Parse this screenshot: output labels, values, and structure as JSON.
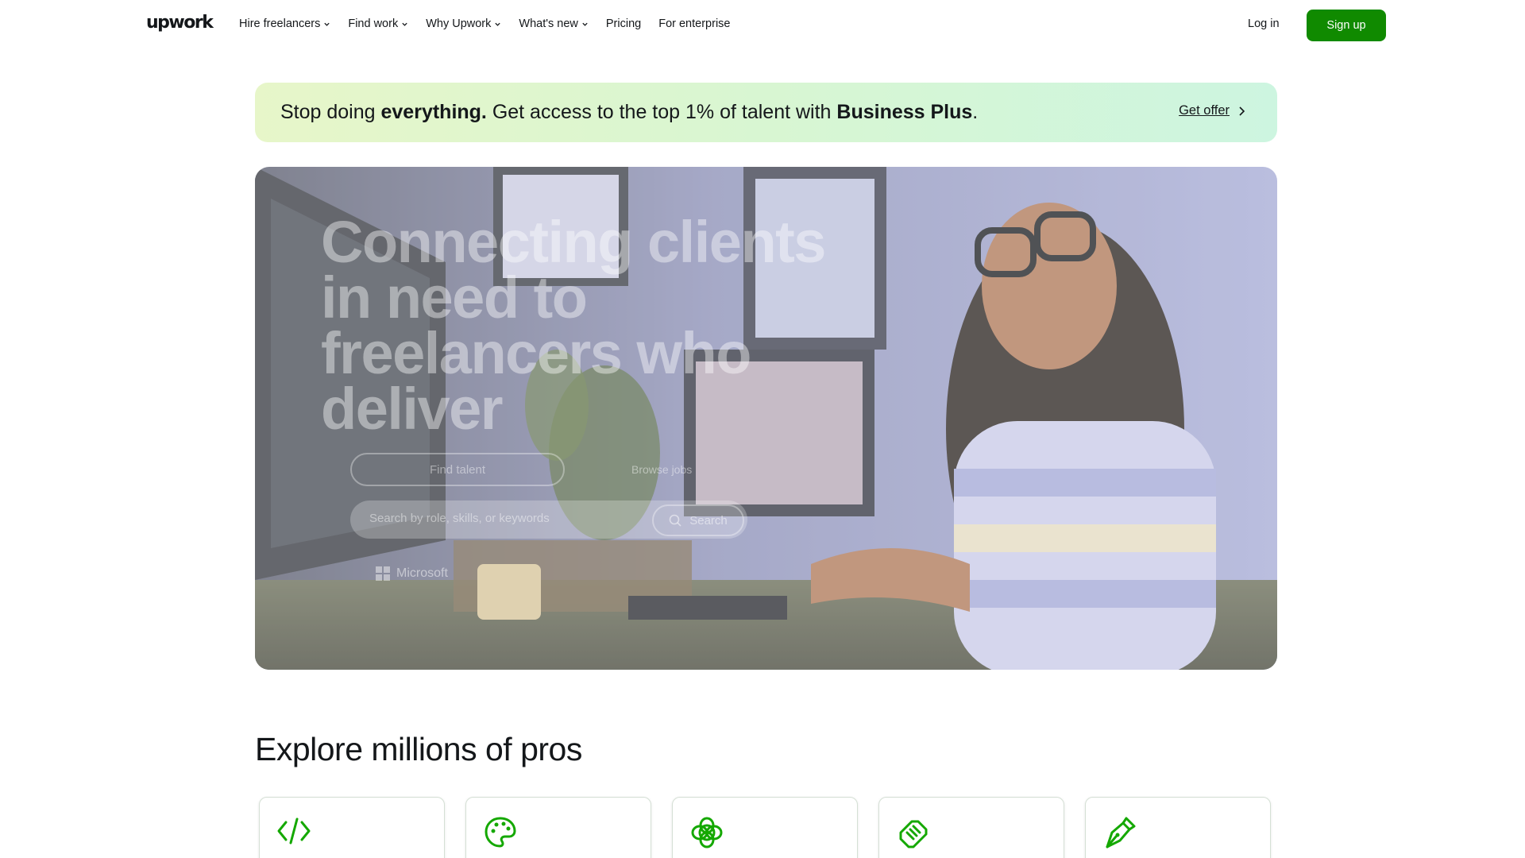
{
  "header": {
    "logo_text": "upwork",
    "nav": [
      {
        "label": "Hire freelancers",
        "has_dropdown": true
      },
      {
        "label": "Find work",
        "has_dropdown": true
      },
      {
        "label": "Why Upwork",
        "has_dropdown": true
      },
      {
        "label": "What's new",
        "has_dropdown": true
      },
      {
        "label": "Pricing",
        "has_dropdown": false
      },
      {
        "label": "For enterprise",
        "has_dropdown": false
      }
    ],
    "login_label": "Log in",
    "signup_label": "Sign up"
  },
  "banner": {
    "text_1": "Stop doing ",
    "text_bold_1": "everything.",
    "text_2": " Get access to the top 1% of talent with ",
    "text_bold_2": "Business Plus",
    "text_3": ".",
    "cta_label": "Get offer"
  },
  "hero": {
    "title": "Connecting clients in need to freelancers who deliver",
    "tab_active": "Find talent",
    "tab_other": "Browse jobs",
    "search_placeholder": "Search by role, skills, or keywords",
    "search_button": "Search",
    "trusted_logo": "Microsoft"
  },
  "explore": {
    "heading": "Explore millions of pros",
    "categories": [
      {
        "icon": "code-icon"
      },
      {
        "icon": "palette-icon"
      },
      {
        "icon": "ai-flower-icon"
      },
      {
        "icon": "handshake-icon"
      },
      {
        "icon": "pen-nib-icon"
      }
    ]
  },
  "colors": {
    "brand_green": "#108a00",
    "icon_green": "#14a800"
  }
}
